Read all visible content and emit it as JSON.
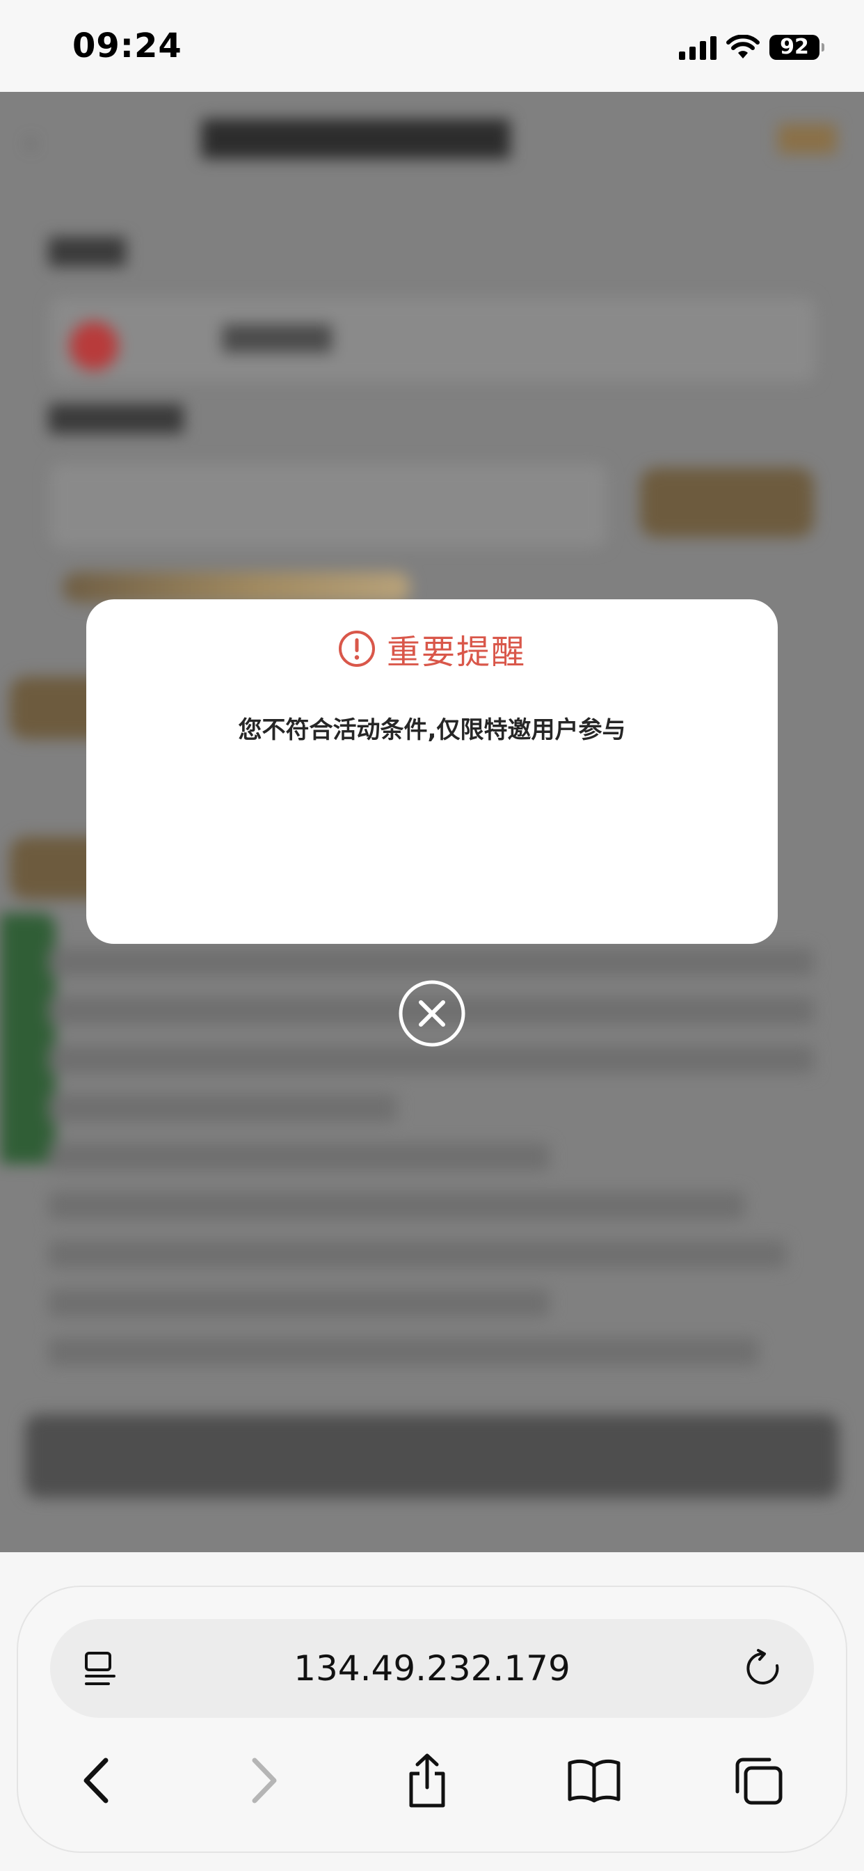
{
  "status_bar": {
    "time": "09:24",
    "battery_level": "92",
    "icons": [
      "signal-icon",
      "wifi-icon",
      "battery-icon"
    ]
  },
  "dialog": {
    "title": "重要提醒",
    "message": "您不符合活动条件,仅限特邀用户参与",
    "title_color": "#d9574a",
    "icons": [
      "alert-icon",
      "close-icon"
    ]
  },
  "browser": {
    "url": "134.49.232.179",
    "icons": [
      "reader-icon",
      "reload-icon",
      "back-icon",
      "forward-icon",
      "share-icon",
      "bookmarks-icon",
      "tabs-icon"
    ]
  }
}
